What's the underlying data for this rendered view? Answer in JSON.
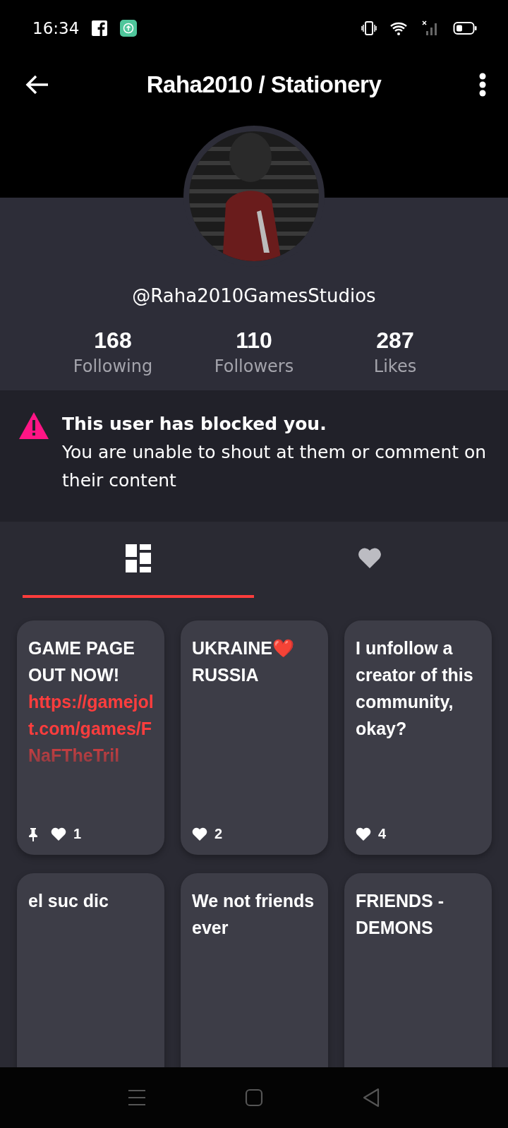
{
  "status_bar": {
    "time": "16:34"
  },
  "header": {
    "title": "Raha2010 / Stationery"
  },
  "profile": {
    "username": "@Raha2010GamesStudios",
    "stats": [
      {
        "value": "168",
        "label": "Following"
      },
      {
        "value": "110",
        "label": "Followers"
      },
      {
        "value": "287",
        "label": "Likes"
      }
    ]
  },
  "notice": {
    "title": "This user has blocked you.",
    "message": "You are unable to shout at them or comment on their content"
  },
  "tabs": [
    {
      "kind": "posts",
      "selected": true
    },
    {
      "kind": "likes",
      "selected": false
    }
  ],
  "posts": [
    {
      "text": "GAME PAGE OUT NOW!",
      "link": "https://gamejolt.com/games/FNaFTheTril",
      "pinned": true,
      "likes": "1"
    },
    {
      "text": "UKRAINE❤️ RUSSIA",
      "pinned": false,
      "likes": "2"
    },
    {
      "text": "I unfollow a creator of this community, okay?",
      "pinned": false,
      "likes": "4"
    },
    {
      "text": "el suc dic",
      "pinned": false
    },
    {
      "text": "We not friends ever",
      "pinned": false
    },
    {
      "text": "FRIENDS - DEMONS",
      "pinned": false
    }
  ]
}
